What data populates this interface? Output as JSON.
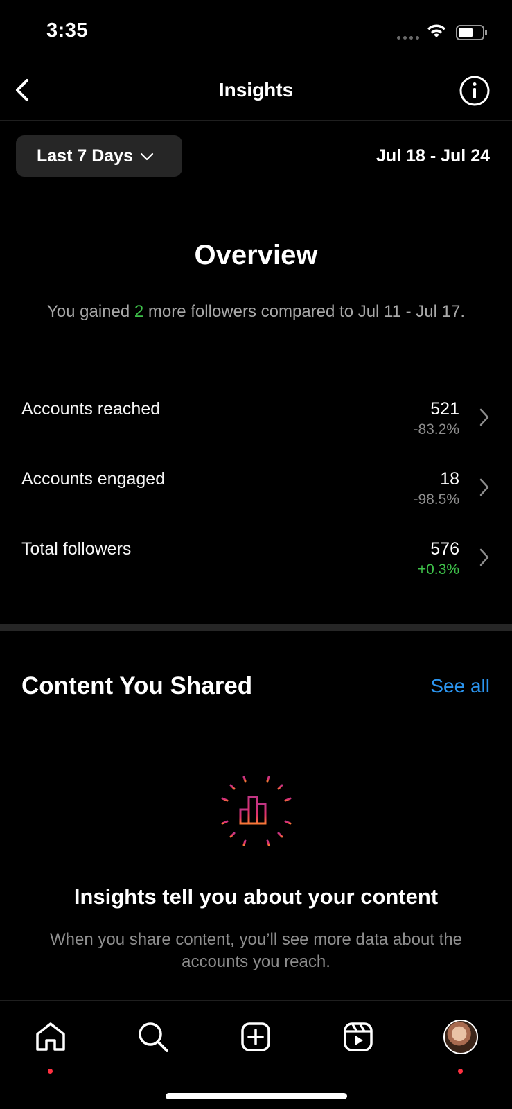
{
  "status_bar": {
    "time": "3:35"
  },
  "header": {
    "title": "Insights"
  },
  "filter": {
    "range_label": "Last 7 Days",
    "date_range": "Jul 18 - Jul 24"
  },
  "overview": {
    "title": "Overview",
    "subtitle_prefix": "You gained ",
    "subtitle_highlight": "2",
    "subtitle_suffix": " more followers compared to Jul 11 - Jul 17.",
    "metrics": [
      {
        "label": "Accounts reached",
        "value": "521",
        "change": "-83.2%"
      },
      {
        "label": "Accounts engaged",
        "value": "18",
        "change": "-98.5%"
      },
      {
        "label": "Total followers",
        "value": "576",
        "change": "+0.3%"
      }
    ]
  },
  "content_shared": {
    "title": "Content You Shared",
    "see_all": "See all",
    "empty_title": "Insights tell you about your content",
    "empty_desc": "When you share content, you’ll see more data about the accounts you reach."
  },
  "tab_bar": {
    "items": [
      {
        "icon": "home-icon",
        "dot": true
      },
      {
        "icon": "search-icon",
        "dot": false
      },
      {
        "icon": "create-icon",
        "dot": false
      },
      {
        "icon": "reels-icon",
        "dot": false
      },
      {
        "icon": "profile-avatar",
        "dot": true
      }
    ]
  },
  "colors": {
    "background": "#000000",
    "positive": "#3ec14a",
    "link": "#2b95f0",
    "notification": "#ff3040"
  }
}
